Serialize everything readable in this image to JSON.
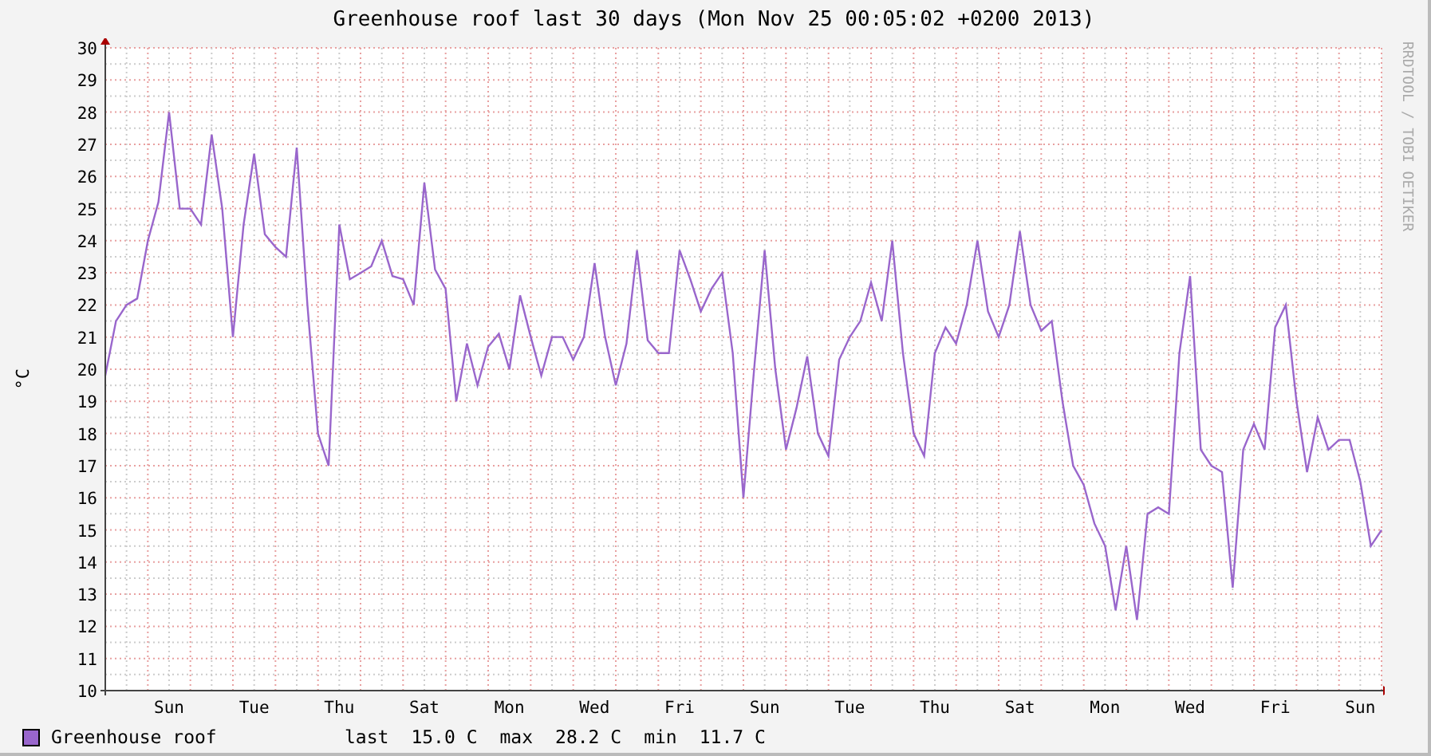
{
  "chart": {
    "chart_data": {
      "type": "line",
      "title": "Greenhouse roof last 30 days (Mon Nov 25 00:05:02 +0200 2013)",
      "ylabel": "°C",
      "grid": true,
      "ylim": [
        10,
        30
      ],
      "yticks": [
        10,
        11,
        12,
        13,
        14,
        15,
        16,
        17,
        18,
        19,
        20,
        21,
        22,
        23,
        24,
        25,
        26,
        27,
        28,
        29,
        30
      ],
      "categories": [
        null,
        null,
        null,
        null,
        null,
        null,
        "Sun",
        null,
        null,
        null,
        null,
        null,
        null,
        null,
        "Tue",
        null,
        null,
        null,
        null,
        null,
        null,
        null,
        "Thu",
        null,
        null,
        null,
        null,
        null,
        null,
        null,
        "Sat",
        null,
        null,
        null,
        null,
        null,
        null,
        null,
        "Mon",
        null,
        null,
        null,
        null,
        null,
        null,
        null,
        "Wed",
        null,
        null,
        null,
        null,
        null,
        null,
        null,
        "Fri",
        null,
        null,
        null,
        null,
        null,
        null,
        null,
        "Sun",
        null,
        null,
        null,
        null,
        null,
        null,
        null,
        "Tue",
        null,
        null,
        null,
        null,
        null,
        null,
        null,
        "Thu",
        null,
        null,
        null,
        null,
        null,
        null,
        null,
        "Sat",
        null,
        null,
        null,
        null,
        null,
        null,
        null,
        "Mon",
        null,
        null,
        null,
        null,
        null,
        null,
        null,
        "Wed",
        null,
        null,
        null,
        null,
        null,
        null,
        null,
        "Fri",
        null,
        null,
        null,
        null,
        null,
        null,
        null,
        "Sun",
        null,
        null
      ],
      "series": [
        {
          "name": "Greenhouse roof",
          "color": "#9966cc",
          "values": [
            19.8,
            21.5,
            22,
            22.2,
            24,
            25.2,
            28,
            25,
            25,
            24.5,
            27.3,
            25,
            21,
            24.5,
            26.7,
            24.2,
            23.8,
            23.5,
            26.9,
            22,
            18,
            17,
            24.5,
            22.8,
            23,
            23.2,
            24,
            22.9,
            22.8,
            22,
            25.8,
            23.1,
            22.5,
            19,
            20.8,
            19.5,
            20.7,
            21.1,
            20,
            22.3,
            21,
            19.8,
            21,
            21,
            20.3,
            21,
            23.3,
            21,
            19.5,
            20.8,
            23.7,
            20.9,
            20.5,
            20.5,
            23.7,
            22.8,
            21.8,
            22.5,
            23,
            20.5,
            16,
            20,
            23.7,
            20,
            17.5,
            18.8,
            20.4,
            18,
            17.3,
            20.3,
            21,
            21.5,
            22.7,
            21.5,
            24,
            20.5,
            18,
            17.3,
            20.5,
            21.3,
            20.8,
            22,
            24,
            21.8,
            21,
            22,
            24.3,
            22,
            21.2,
            21.5,
            19,
            17,
            16.4,
            15.2,
            14.5,
            12.5,
            14.5,
            12.2,
            15.5,
            15.7,
            15.5,
            20.5,
            22.9,
            17.5,
            17,
            16.8,
            13.2,
            17.5,
            18.3,
            17.5,
            21.3,
            22,
            19,
            16.8,
            18.5,
            17.5,
            17.8,
            17.8,
            16.5,
            14.5,
            15
          ]
        }
      ]
    }
  },
  "credit": "RRDTOOL / TOBI OETIKER",
  "legend": {
    "stats": [
      {
        "label": "last",
        "value": "15.0 C"
      },
      {
        "label": "max",
        "value": "28.2 C"
      },
      {
        "label": "min",
        "value": "11.7 C"
      }
    ]
  }
}
